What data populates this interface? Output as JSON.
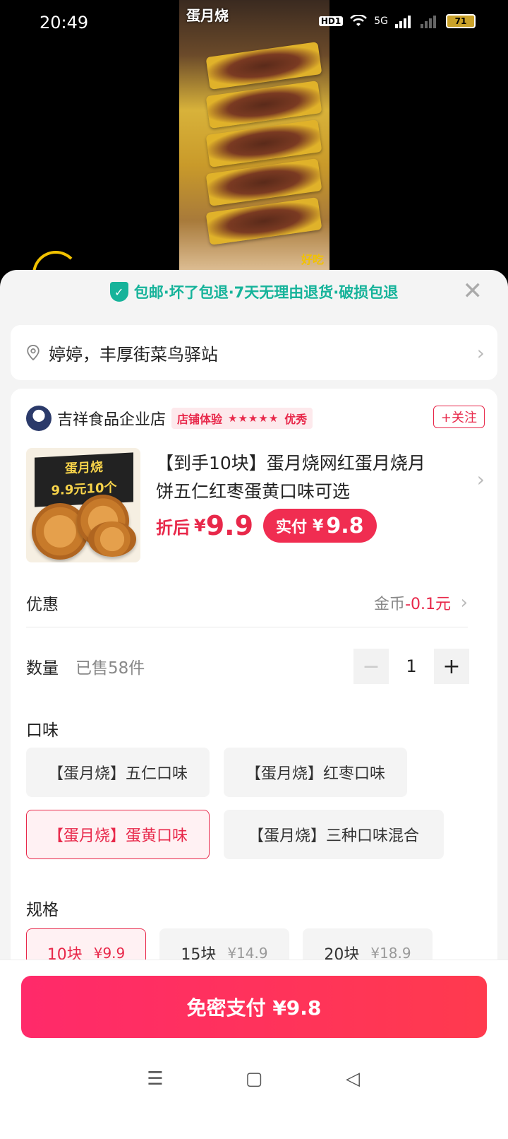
{
  "status": {
    "time": "20:49",
    "hd": "HD1",
    "net": "5G",
    "battery": "71"
  },
  "video": {
    "caption": "蛋月烧",
    "sticker": "好吃"
  },
  "guarantee": {
    "text": "包邮·坏了包退·7天无理由退货·破损包退",
    "shield_check": "✓"
  },
  "close_symbol": "✕",
  "address": {
    "text": "婷婷，丰厚街菜鸟驿站"
  },
  "store": {
    "name": "吉祥食品企业店",
    "badge_label": "店铺体验",
    "stars": "★★★★★",
    "rating_word": "优秀",
    "follow": "+关注"
  },
  "product": {
    "box_label_line1": "蛋月烧",
    "box_label_line2": "9.9元10个",
    "title": "【到手10块】蛋月烧网红蛋月烧月饼五仁红枣蛋黄口味可选",
    "price_label": "折后",
    "currency": "¥",
    "price": "9.9",
    "pay_label": "实付",
    "pay_price": "9.8"
  },
  "discount": {
    "label": "优惠",
    "value_prefix": "金币",
    "value": "-0.1元"
  },
  "quantity": {
    "label": "数量",
    "sold": "已售58件",
    "minus": "−",
    "value": "1",
    "plus": "+"
  },
  "flavor": {
    "title": "口味",
    "options": [
      "【蛋月烧】五仁口味",
      "【蛋月烧】红枣口味",
      "【蛋月烧】蛋黄口味",
      "【蛋月烧】三种口味混合"
    ],
    "selected_index": 2
  },
  "spec": {
    "title": "规格",
    "options": [
      {
        "label": "10块",
        "price": "¥9.9"
      },
      {
        "label": "15块",
        "price": "¥14.9"
      },
      {
        "label": "20块",
        "price": "¥18.9"
      }
    ],
    "selected_index": 0
  },
  "pay_button": {
    "label": "免密支付 ¥9.8"
  },
  "nav": {
    "menu": "☰",
    "home": "▢",
    "back": "◁"
  },
  "colors": {
    "accent": "#e8284a",
    "guarantee": "#16b39a",
    "pay_button": "#ff3a4e"
  }
}
